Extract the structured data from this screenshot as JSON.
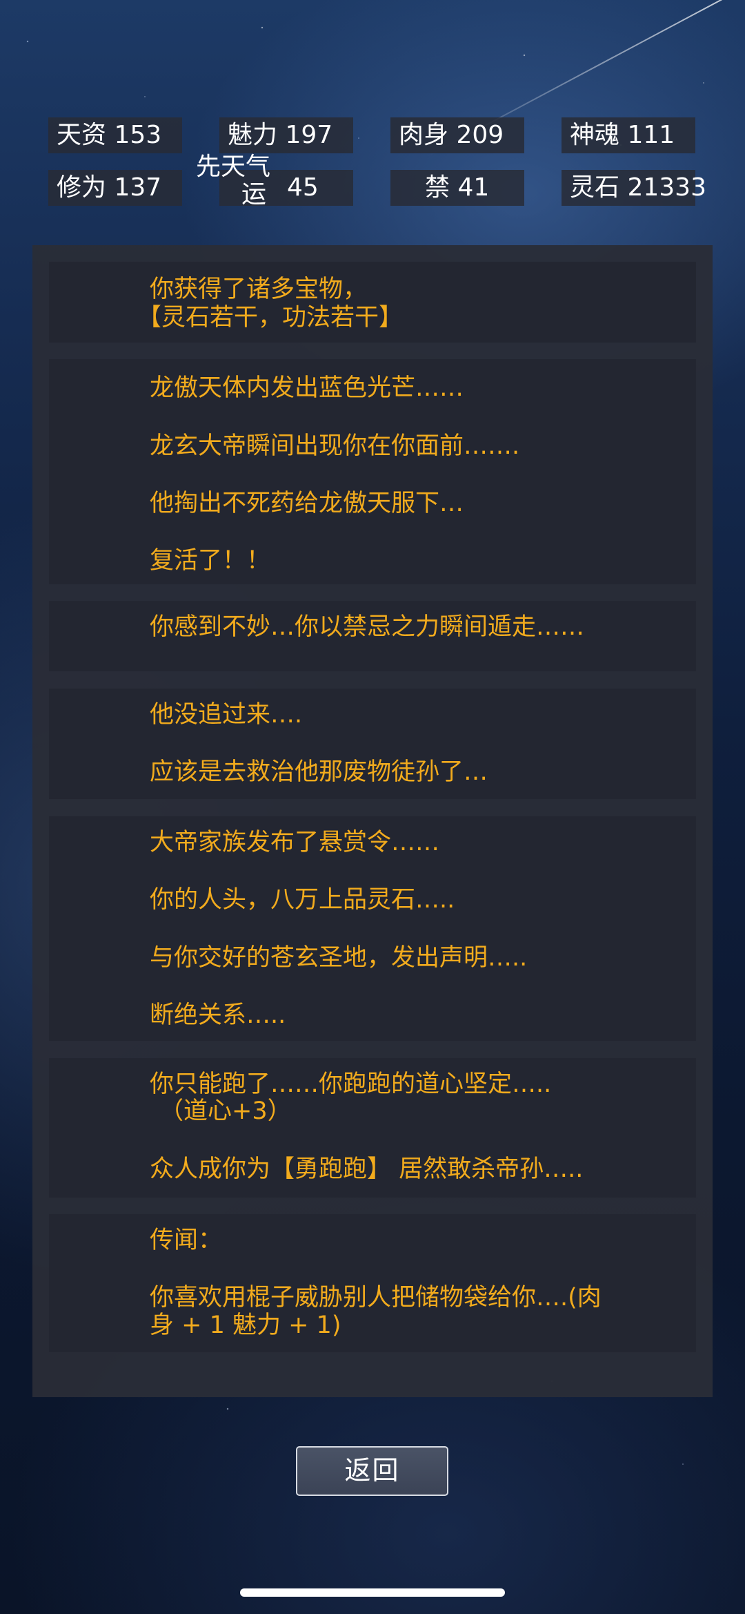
{
  "stats": {
    "tianzi": {
      "label": "天资",
      "value": "153"
    },
    "meili": {
      "label": "魅力",
      "value": "197"
    },
    "roushen": {
      "label": "肉身",
      "value": "209"
    },
    "shenhun": {
      "label": "神魂",
      "value": "111"
    },
    "xiuwei": {
      "label": "修为",
      "value": "137"
    },
    "qiyun": {
      "label_line1": "先天气",
      "label_line2": "运",
      "value": "45"
    },
    "jin": {
      "label": "禁",
      "value": "41"
    },
    "lingshi": {
      "label": "灵石",
      "value": "21333"
    }
  },
  "log": [
    {
      "lines": [
        "你获得了诸多宝物，",
        "【灵石若干，功法若干】"
      ]
    },
    {
      "lines": [
        "龙傲天体内发出蓝色光芒……",
        "龙玄大帝瞬间出现你在你面前…….",
        "他掏出不死药给龙傲天服下…",
        "复活了！！"
      ]
    },
    {
      "lines": [
        "你感到不妙…你以禁忌之力瞬间遁走……"
      ]
    },
    {
      "lines": [
        "他没追过来….",
        "应该是去救治他那废物徒孙了…"
      ]
    },
    {
      "lines": [
        "大帝家族发布了悬赏令……",
        "你的人头，八万上品灵石…..",
        "与你交好的苍玄圣地，发出声明…..",
        "断绝关系….."
      ]
    },
    {
      "lines": [
        "你只能跑了……你跑跑的道心坚定…..",
        "（道心+3）",
        "众人成你为【勇跑跑】 居然敢杀帝孙….."
      ]
    },
    {
      "lines": [
        "传闻：",
        "你喜欢用棍子威胁别人把储物袋给你….(肉",
        "身 + 1 魅力 + 1)"
      ]
    }
  ],
  "back_button": {
    "label": "返回"
  }
}
